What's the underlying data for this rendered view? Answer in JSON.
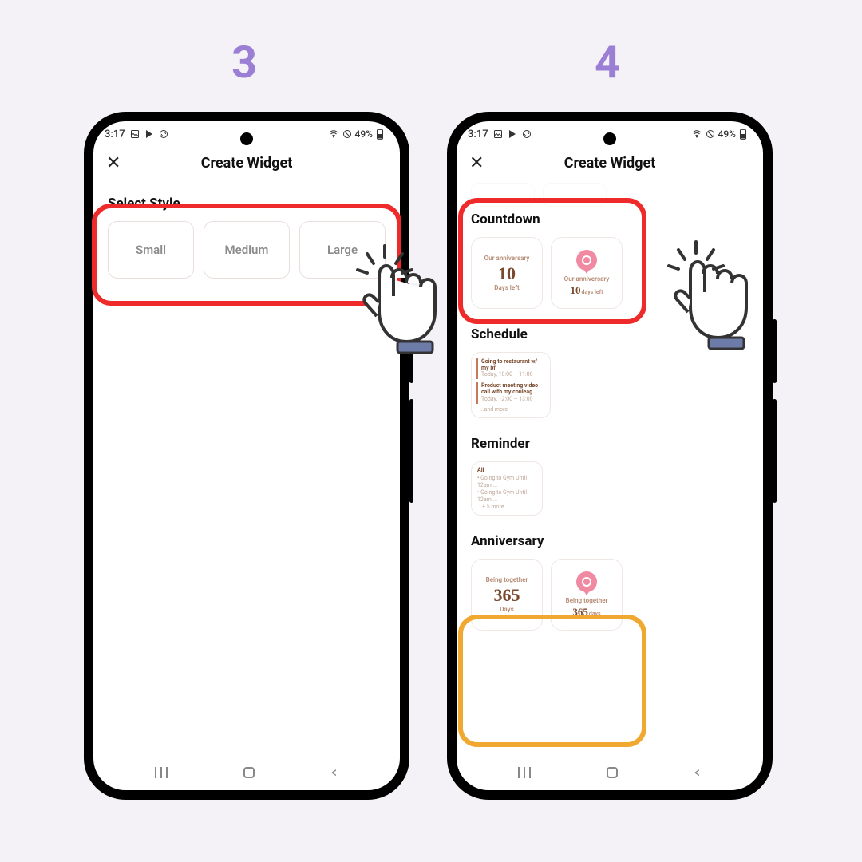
{
  "steps": {
    "s3": "3",
    "s4": "4"
  },
  "statusbar": {
    "time": "3:17",
    "battery": "49%"
  },
  "header": {
    "title": "Create Widget"
  },
  "style": {
    "heading": "Select Style",
    "options": [
      "Small",
      "Medium",
      "Large"
    ]
  },
  "countdown": {
    "heading": "Countdown",
    "card1": {
      "title": "Our anniversary",
      "number": "10",
      "unit": "Days left"
    },
    "card2": {
      "title": "Our anniversary",
      "number": "10",
      "unit": "days left"
    }
  },
  "schedule": {
    "heading": "Schedule",
    "items": [
      {
        "t": "Going to restaurant w/ my bf",
        "s": "Today, 10:00 – 11:00"
      },
      {
        "t": "Product meeting video call with my couleag...",
        "s": "Today, 12:00 – 13:00"
      }
    ],
    "more": "...and more"
  },
  "reminder": {
    "heading": "Reminder",
    "title": "All",
    "items": [
      "Going to Gym Until 12am ...",
      "Going to Gym Until 12am ..."
    ],
    "more": "+ 5 more"
  },
  "anniversary": {
    "heading": "Anniversary",
    "card1": {
      "title": "Being together",
      "number": "365",
      "unit": "Days"
    },
    "card2": {
      "title": "Being together",
      "number": "365",
      "unit": "days"
    }
  }
}
